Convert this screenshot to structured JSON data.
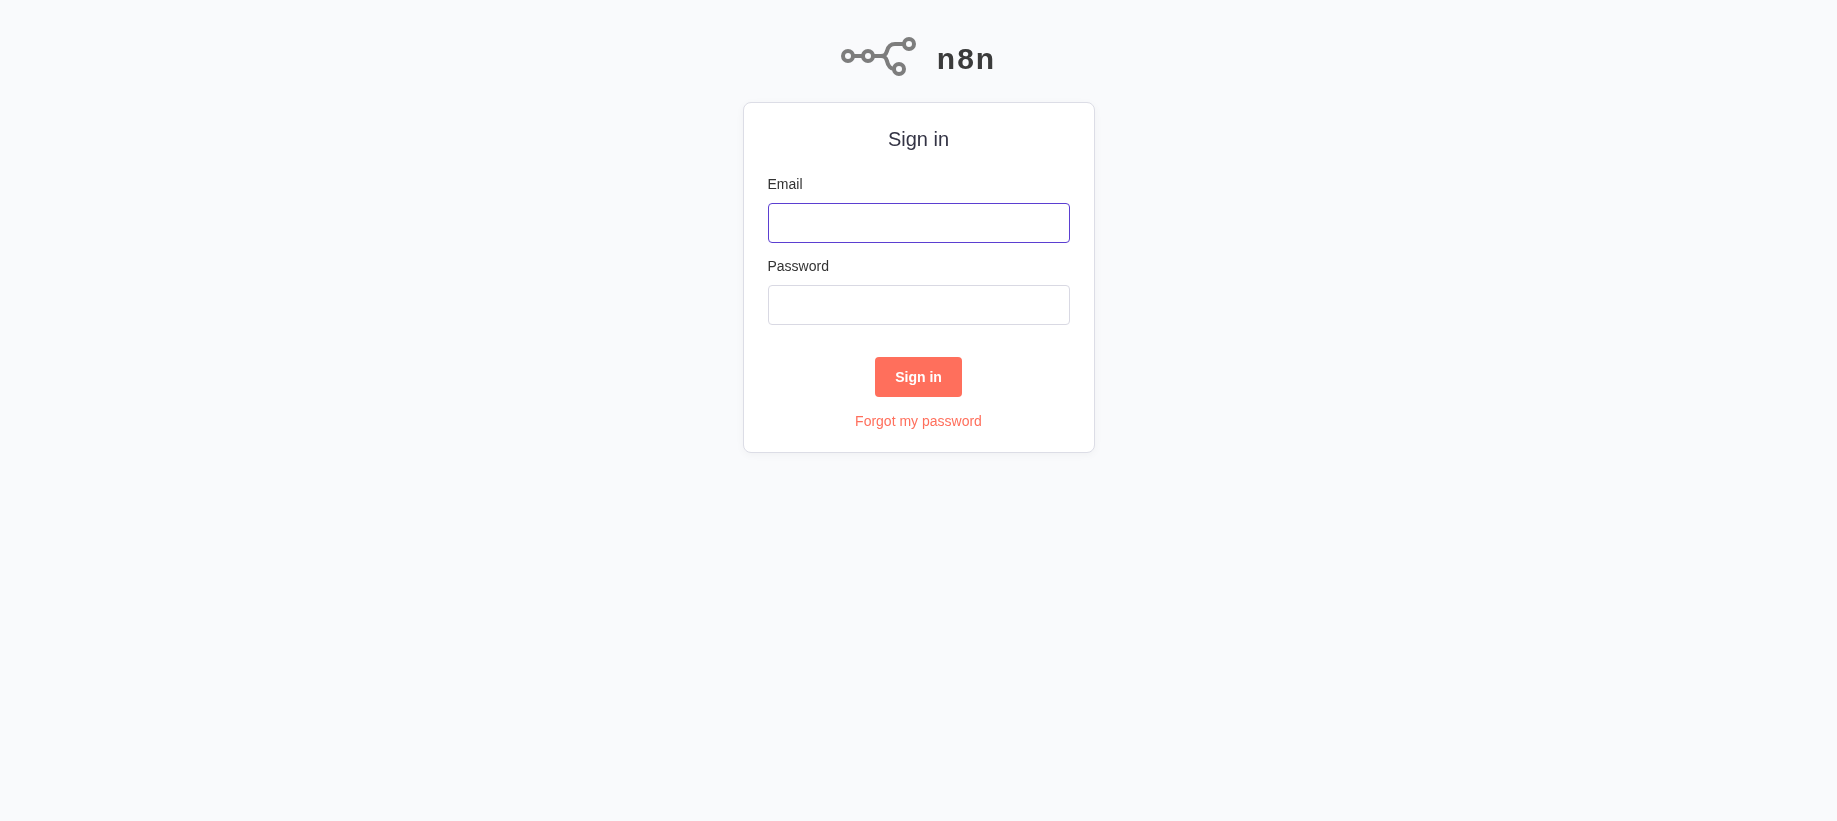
{
  "logo": {
    "wordmark": "n8n"
  },
  "form": {
    "title": "Sign in",
    "fields": [
      {
        "label": "Email",
        "focused": true
      },
      {
        "label": "Password",
        "focused": false
      }
    ],
    "submit": "Sign in",
    "link": "Forgot my password"
  }
}
